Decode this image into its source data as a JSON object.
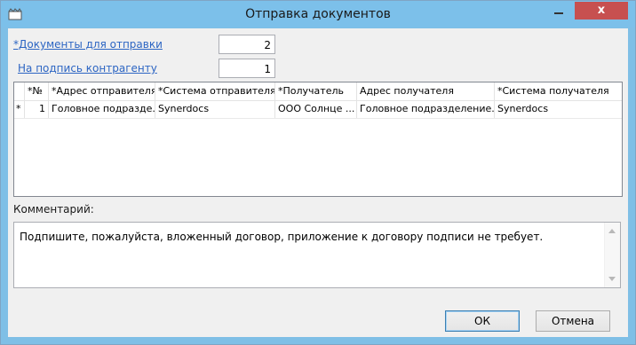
{
  "window": {
    "title": "Отправка документов",
    "close_label": "x"
  },
  "fields": {
    "documents_label": "*Документы для отправки",
    "documents_value": "2",
    "sign_label": "На подпись контрагенту",
    "sign_value": "1"
  },
  "grid": {
    "columns": [
      "*№",
      "*Адрес отправителя",
      "*Система отправителя",
      "*Получатель",
      "Адрес получателя",
      "*Система получателя"
    ],
    "rows": [
      {
        "marker": "*",
        "num": "1",
        "sender_address": "Головное подразде...",
        "sender_system": "Synerdocs",
        "recipient": "ООО Солнце ...",
        "recipient_address": "Головное подразделение...",
        "recipient_system": "Synerdocs"
      }
    ]
  },
  "comment": {
    "label": "Комментарий:",
    "text": "Подпишите, пожалуйста, вложенный договор, приложение к договору подписи не требует."
  },
  "buttons": {
    "ok": "ОК",
    "cancel": "Отмена"
  },
  "colors": {
    "titlebar": "#7cc0ea",
    "close": "#c75050",
    "link": "#2c65c3"
  }
}
